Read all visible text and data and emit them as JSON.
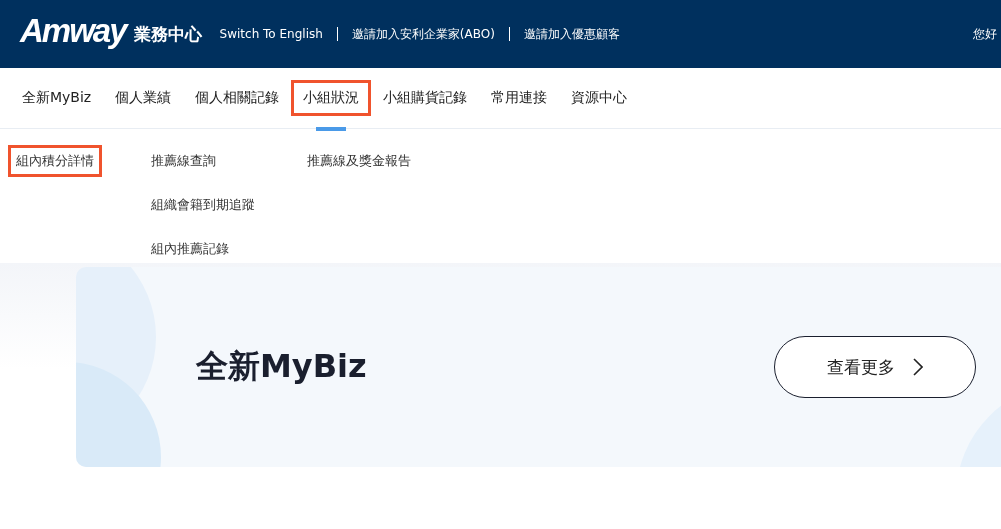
{
  "header": {
    "logo": "Amway",
    "subtitle": "業務中心",
    "links": [
      {
        "label": "Switch To English"
      },
      {
        "label": "邀請加入安利企業家(ABO)"
      },
      {
        "label": "邀請加入優惠顧客"
      }
    ],
    "greeting": "您好"
  },
  "nav": [
    {
      "label": "全新MyBiz",
      "selected": false,
      "highlighted": false
    },
    {
      "label": "個人業績",
      "selected": false,
      "highlighted": false
    },
    {
      "label": "個人相關記錄",
      "selected": false,
      "highlighted": false
    },
    {
      "label": "小組狀況",
      "selected": true,
      "highlighted": true
    },
    {
      "label": "小組購貨記錄",
      "selected": false,
      "highlighted": false
    },
    {
      "label": "常用連接",
      "selected": false,
      "highlighted": false
    },
    {
      "label": "資源中心",
      "selected": false,
      "highlighted": false
    }
  ],
  "submenu": [
    [
      {
        "label": "組內積分詳情",
        "highlighted": true
      }
    ],
    [
      {
        "label": "推薦線查詢",
        "highlighted": false
      },
      {
        "label": "組織會籍到期追蹤",
        "highlighted": false
      },
      {
        "label": "組內推薦記錄",
        "highlighted": false
      }
    ],
    [
      {
        "label": "推薦線及獎金報告",
        "highlighted": false
      }
    ]
  ],
  "banner": {
    "title": "全新MyBiz",
    "button": "查看更多"
  }
}
